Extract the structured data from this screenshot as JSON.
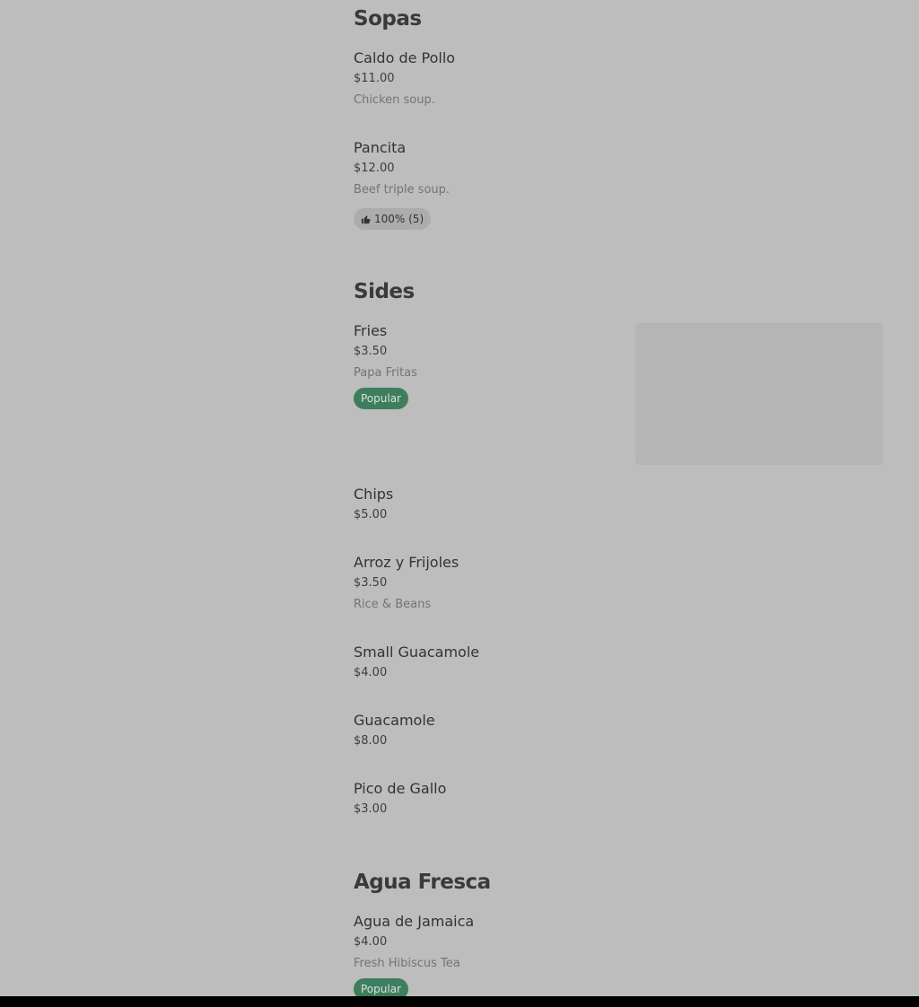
{
  "sections": [
    {
      "title": "Sopas",
      "items": [
        {
          "name": "Caldo de Pollo",
          "price": "$11.00",
          "description": "Chicken soup."
        },
        {
          "name": "Pancita",
          "price": "$12.00",
          "description": "Beef triple soup.",
          "rating": "100% (5)",
          "rating_icon": "thumbs-up-icon"
        }
      ]
    },
    {
      "title": "Sides",
      "items": [
        {
          "name": "Fries",
          "price": "$3.50",
          "description": "Papa Fritas",
          "badge": "Popular"
        },
        {
          "name": "Chips",
          "price": "$5.00"
        },
        {
          "name": "Arroz y Frijoles",
          "price": "$3.50",
          "description": "Rice & Beans"
        },
        {
          "name": "Small Guacamole",
          "price": "$4.00"
        },
        {
          "name": "Guacamole",
          "price": "$8.00"
        },
        {
          "name": "Pico de Gallo",
          "price": "$3.00"
        }
      ]
    },
    {
      "title": "Agua Fresca",
      "items": [
        {
          "name": "Agua de Jamaica",
          "price": "$4.00",
          "description": "Fresh Hibiscus Tea",
          "badge": "Popular"
        }
      ]
    }
  ],
  "colors": {
    "background": "#bdbdbd",
    "popular_badge": "#3e7e5e",
    "rating_badge": "#acacac",
    "bottom_bar": "#000000"
  }
}
